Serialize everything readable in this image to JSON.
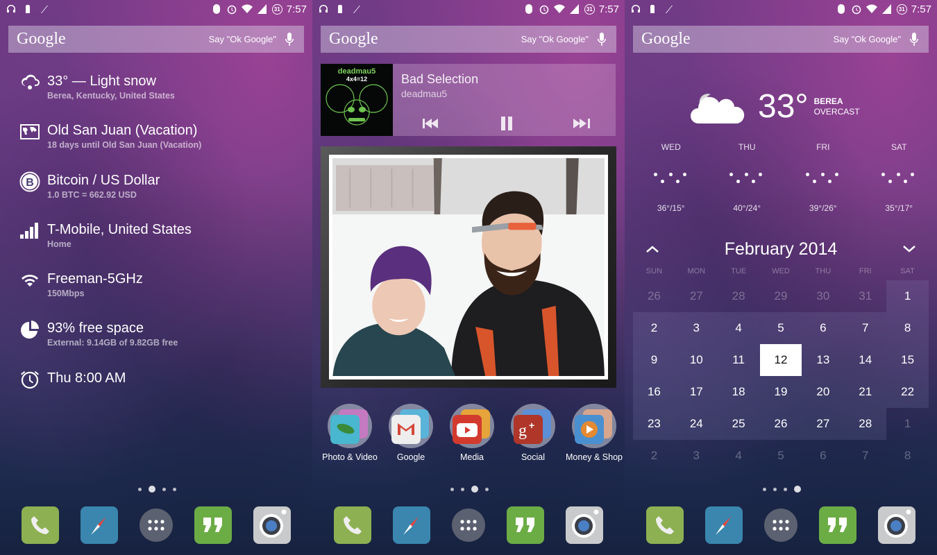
{
  "status_bar": {
    "time": "7:57",
    "calendar_badge": "31",
    "left_icons": [
      "headphones-icon",
      "battery-icon",
      "signal-arrow-icon"
    ],
    "right_icons": [
      "bluetooth-icon",
      "alarm-icon",
      "wifi-icon",
      "cell-signal-icon",
      "calendar-icon"
    ]
  },
  "google_bar": {
    "logo": "Google",
    "hint": "Say \"Ok Google\""
  },
  "screen1": {
    "items": [
      {
        "icon": "weather-snow-icon",
        "title": "33° — Light snow",
        "subtitle": "Berea, Kentucky, United States"
      },
      {
        "icon": "world-map-icon",
        "title": "Old San Juan (Vacation)",
        "subtitle": "18 days until Old San Juan (Vacation)"
      },
      {
        "icon": "bitcoin-icon",
        "title": "Bitcoin / US Dollar",
        "subtitle": "1.0 BTC = 662.92 USD"
      },
      {
        "icon": "cell-signal-icon",
        "title": "T-Mobile, United States",
        "subtitle": "Home"
      },
      {
        "icon": "wifi-icon",
        "title": "Freeman-5GHz",
        "subtitle": "150Mbps"
      },
      {
        "icon": "pie-chart-icon",
        "title": "93% free space",
        "subtitle": "External: 9.14GB of 9.82GB free"
      },
      {
        "icon": "alarm-clock-icon",
        "title": "Thu 8:00 AM",
        "subtitle": ""
      }
    ],
    "page_indicator": {
      "count": 4,
      "active": 2
    }
  },
  "screen2": {
    "music": {
      "song": "Bad Selection",
      "artist": "deadmau5",
      "album_art_text": "deadmau5",
      "album_art_sub": "4x4=12"
    },
    "folders": [
      {
        "label": "Photo & Video"
      },
      {
        "label": "Google"
      },
      {
        "label": "Media"
      },
      {
        "label": "Social"
      },
      {
        "label": "Money & Shop"
      }
    ],
    "page_indicator": {
      "count": 4,
      "active": 3
    }
  },
  "screen3": {
    "weather": {
      "temp": "33°",
      "city": "BEREA",
      "condition": "OVERCAST",
      "forecast": [
        {
          "day": "WED",
          "temp": "36°/15°"
        },
        {
          "day": "THU",
          "temp": "40°/24°"
        },
        {
          "day": "FRI",
          "temp": "39°/26°"
        },
        {
          "day": "SAT",
          "temp": "35°/17°"
        }
      ]
    },
    "calendar": {
      "month": "February 2014",
      "dow": [
        "SUN",
        "MON",
        "TUE",
        "WED",
        "THU",
        "FRI",
        "SAT"
      ],
      "today": "12",
      "weeks": [
        [
          {
            "d": "26",
            "o": true
          },
          {
            "d": "27",
            "o": true
          },
          {
            "d": "28",
            "o": true
          },
          {
            "d": "29",
            "o": true
          },
          {
            "d": "30",
            "o": true
          },
          {
            "d": "31",
            "o": true
          },
          {
            "d": "1",
            "o": false
          }
        ],
        [
          {
            "d": "2",
            "o": false
          },
          {
            "d": "3",
            "o": false
          },
          {
            "d": "4",
            "o": false
          },
          {
            "d": "5",
            "o": false
          },
          {
            "d": "6",
            "o": false
          },
          {
            "d": "7",
            "o": false
          },
          {
            "d": "8",
            "o": false
          }
        ],
        [
          {
            "d": "9",
            "o": false
          },
          {
            "d": "10",
            "o": false
          },
          {
            "d": "11",
            "o": false
          },
          {
            "d": "12",
            "o": false
          },
          {
            "d": "13",
            "o": false
          },
          {
            "d": "14",
            "o": false
          },
          {
            "d": "15",
            "o": false
          }
        ],
        [
          {
            "d": "16",
            "o": false
          },
          {
            "d": "17",
            "o": false
          },
          {
            "d": "18",
            "o": false
          },
          {
            "d": "19",
            "o": false
          },
          {
            "d": "20",
            "o": false
          },
          {
            "d": "21",
            "o": false
          },
          {
            "d": "22",
            "o": false
          }
        ],
        [
          {
            "d": "23",
            "o": false
          },
          {
            "d": "24",
            "o": false
          },
          {
            "d": "25",
            "o": false
          },
          {
            "d": "26",
            "o": false
          },
          {
            "d": "27",
            "o": false
          },
          {
            "d": "28",
            "o": false
          },
          {
            "d": "1",
            "o": true
          }
        ],
        [
          {
            "d": "2",
            "o": true
          },
          {
            "d": "3",
            "o": true
          },
          {
            "d": "4",
            "o": true
          },
          {
            "d": "5",
            "o": true
          },
          {
            "d": "6",
            "o": true
          },
          {
            "d": "7",
            "o": true
          },
          {
            "d": "8",
            "o": true
          }
        ]
      ]
    },
    "page_indicator": {
      "count": 4,
      "active": 4
    }
  },
  "dock": [
    "phone",
    "browser",
    "app-drawer",
    "hangouts",
    "camera"
  ],
  "colors": {
    "phone": "#8db052",
    "browser": "#3a86ae",
    "drawer": "#5b6170",
    "hangouts": "#6cac45",
    "camera": "#c9cacc",
    "album_green": "#7dd35c"
  }
}
